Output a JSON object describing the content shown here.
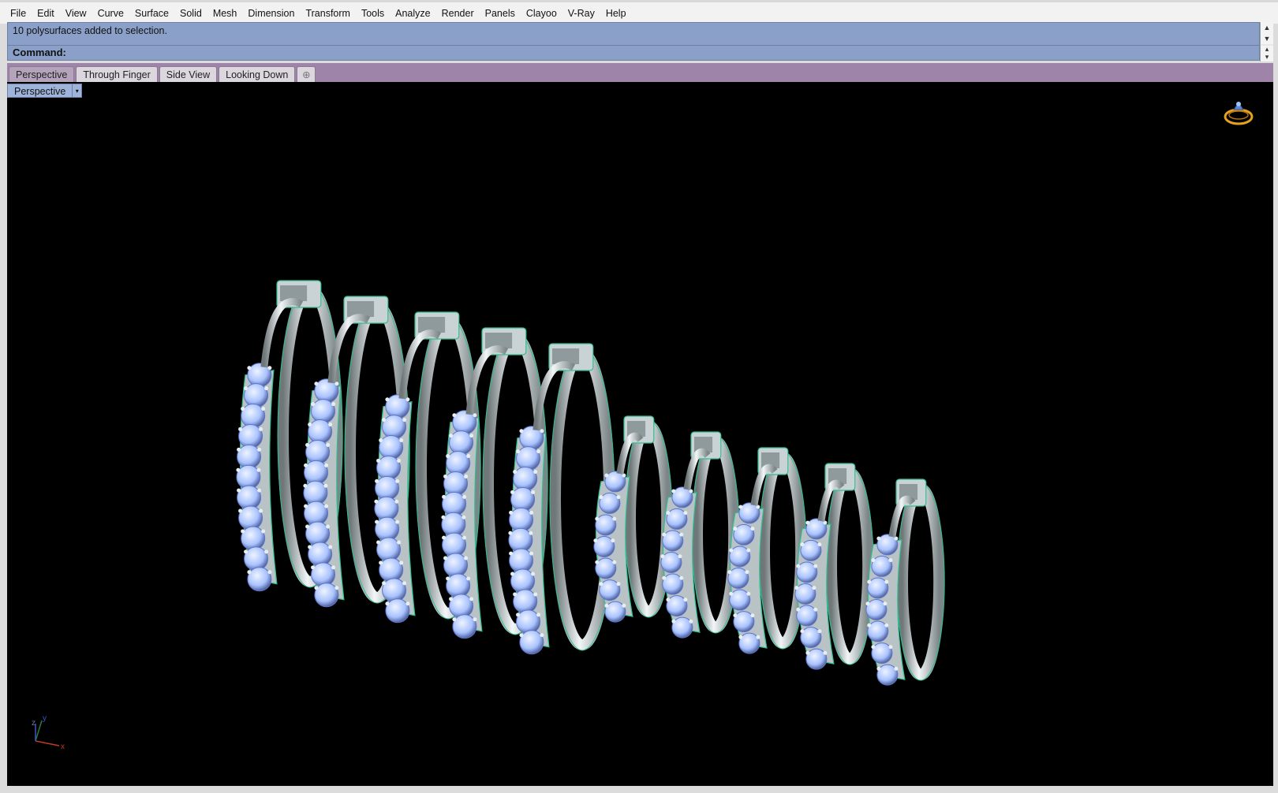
{
  "menu": [
    "File",
    "Edit",
    "View",
    "Curve",
    "Surface",
    "Solid",
    "Mesh",
    "Dimension",
    "Transform",
    "Tools",
    "Analyze",
    "Render",
    "Panels",
    "Clayoo",
    "V-Ray",
    "Help"
  ],
  "history": {
    "text": "10 polysurfaces added to selection."
  },
  "command": {
    "label": "Command:",
    "value": ""
  },
  "viewport_tabs": [
    {
      "label": "Perspective",
      "active": true
    },
    {
      "label": "Through Finger",
      "active": false
    },
    {
      "label": "Side View",
      "active": false
    },
    {
      "label": "Looking Down",
      "active": false
    }
  ],
  "add_tab_symbol": "⊕",
  "viewport": {
    "title": "Perspective",
    "menu_symbol": "▾"
  },
  "axes": {
    "x": "x",
    "y": "y",
    "z": "z"
  },
  "colors": {
    "metal": "#cfd6d8",
    "edge_highlight": "#2fbf8f",
    "gem": "#a9c3ff",
    "viewport_bg": "#000000",
    "command_bg": "#8aa0c8",
    "tabbar_bg": "#9e84a8",
    "ring_icon": "#e5a11d"
  },
  "icons": {
    "view_gizmo": "ring-icon",
    "axes": "axes-icon",
    "scroll_up": "up-arrow-icon",
    "scroll_down": "down-arrow-icon"
  }
}
